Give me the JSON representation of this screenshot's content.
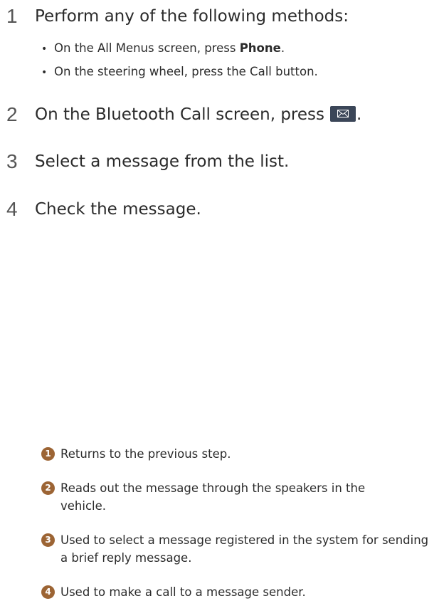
{
  "steps": [
    {
      "num": "1",
      "text": "Perform any of the following methods:"
    },
    {
      "num": "2",
      "text_before": "On the Bluetooth Call screen, press",
      "text_after": "."
    },
    {
      "num": "3",
      "text": "Select a message from the list."
    },
    {
      "num": "4",
      "text": "Check the message."
    }
  ],
  "methods": [
    {
      "before": "On the All Menus screen, press ",
      "bold": "Phone",
      "after": "."
    },
    {
      "before": "On the steering wheel, press the Call button.",
      "bold": "",
      "after": ""
    }
  ],
  "message_button_icon": "envelope-icon",
  "legend": [
    {
      "badge": "1",
      "text": "Returns to the previous step."
    },
    {
      "badge": "2",
      "text": "Reads out the message through the speakers in the vehicle."
    },
    {
      "badge": "3",
      "text": "Used to select a message registered in the system for sending a brief reply message."
    },
    {
      "badge": "4",
      "text": "Used to make a call to a message sender."
    }
  ],
  "colors": {
    "badge": "#9c6434",
    "button": "#3b4658"
  }
}
